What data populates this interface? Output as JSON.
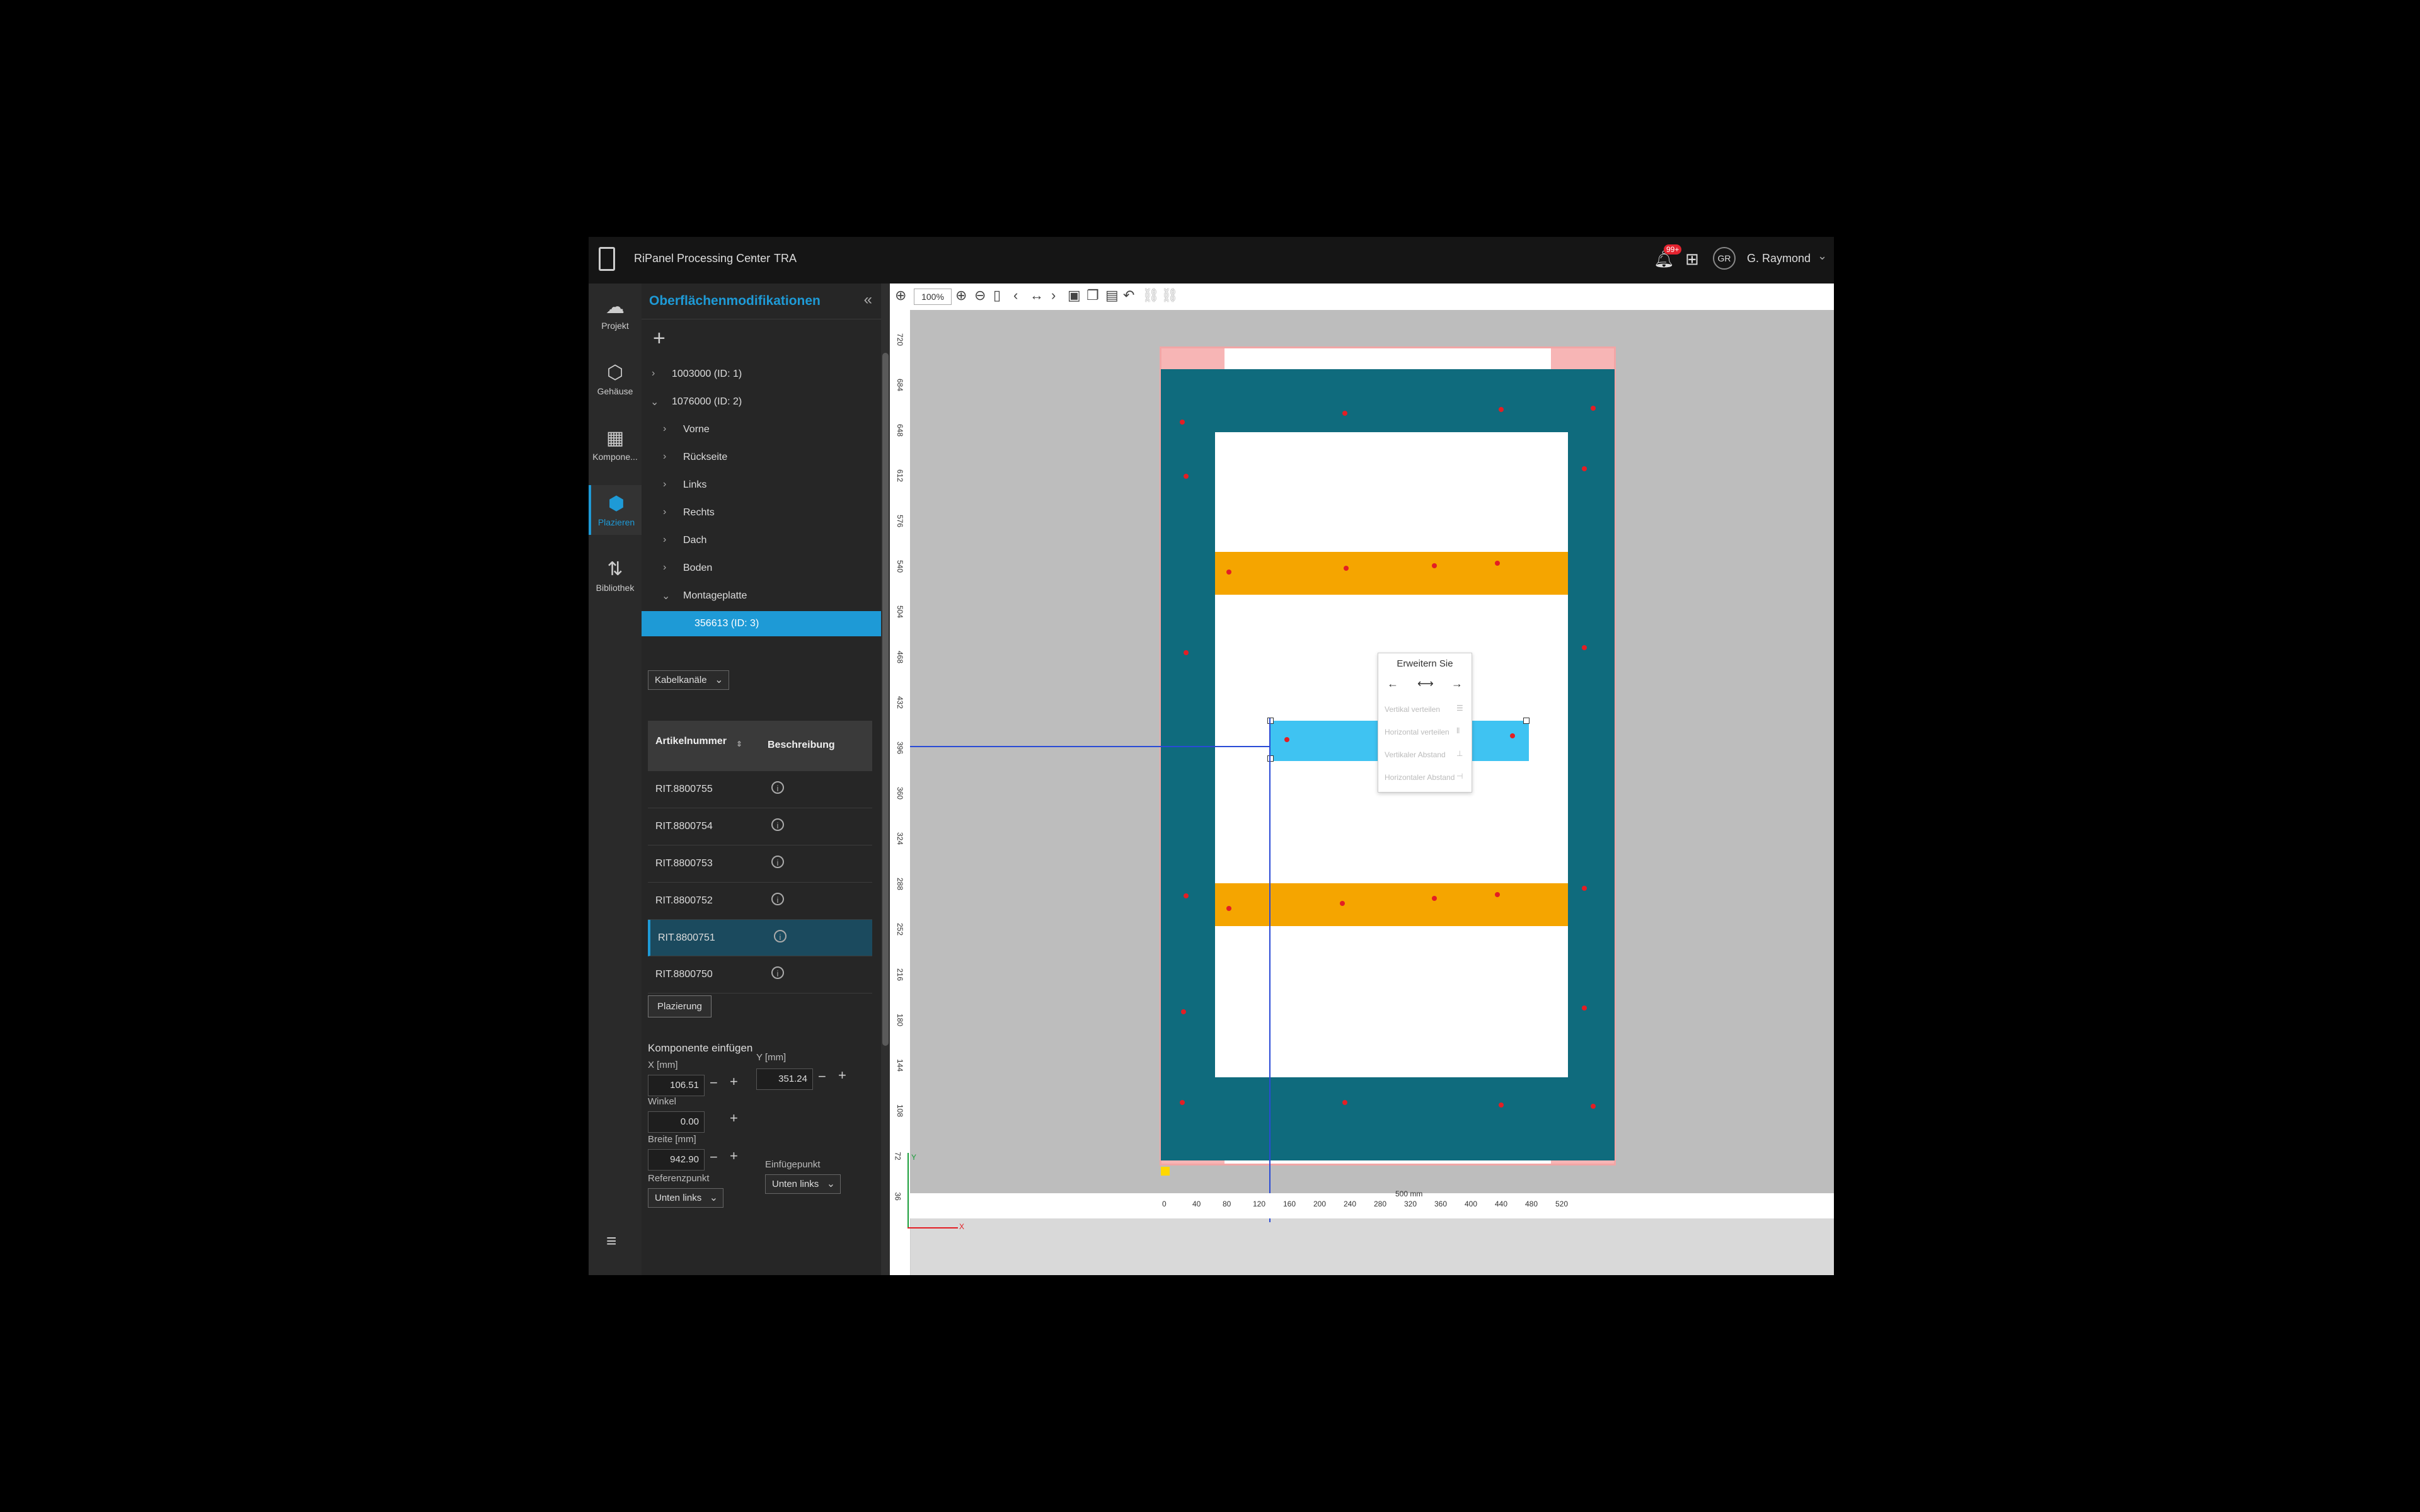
{
  "appbar": {
    "title": "RiPanel Processing Center",
    "breadcrumb_sep": "›",
    "breadcrumb": "TRA",
    "notification_badge": "99+",
    "avatar_initials": "GR",
    "user_name": "G. Raymond"
  },
  "rail": {
    "items": [
      {
        "label": "Projekt",
        "icon": "cloud-icon"
      },
      {
        "label": "Gehäuse",
        "icon": "cube-icon"
      },
      {
        "label": "Kompone...",
        "icon": "grid-icon"
      },
      {
        "label": "Plazieren",
        "icon": "box-place-icon",
        "active": true
      },
      {
        "label": "Bibliothek",
        "icon": "transfer-icon"
      }
    ]
  },
  "panel": {
    "title": "Oberflächenmodifikationen",
    "tree": [
      {
        "label": "1003000 (ID: 1)",
        "expanded": false
      },
      {
        "label": "1076000 (ID: 2)",
        "expanded": true
      },
      {
        "label": "Vorne"
      },
      {
        "label": "Rückseite"
      },
      {
        "label": "Links"
      },
      {
        "label": "Rechts"
      },
      {
        "label": "Dach"
      },
      {
        "label": "Boden"
      },
      {
        "label": "Montageplatte",
        "expanded": true
      },
      {
        "label": "356613 (ID: 3)",
        "selected": true
      }
    ],
    "filter_value": "Kabelkanäle",
    "table": {
      "col1": "Artikelnummer",
      "col2": "Beschreibung",
      "rows": [
        "RIT.8800755",
        "RIT.8800754",
        "RIT.8800753",
        "RIT.8800752",
        "RIT.8800751",
        "RIT.8800750"
      ],
      "selected_index": 4
    },
    "placement_button": "Plazierung",
    "insert_title": "Komponente einfügen",
    "x_label": "X [mm]",
    "x_value": "106.51",
    "y_label": "Y [mm]",
    "y_value": "351.24",
    "angle_label": "Winkel",
    "angle_value": "0.00",
    "width_label": "Breite [mm]",
    "width_value": "942.90",
    "ref_label": "Referenzpunkt",
    "ref_value": "Unten links",
    "insert_point_label": "Einfügepunkt",
    "insert_point_value": "Unten links"
  },
  "toolbar": {
    "zoom": "100%"
  },
  "canvas": {
    "ruler_left": [
      "720",
      "684",
      "648",
      "612",
      "576",
      "540",
      "504",
      "468",
      "432",
      "396",
      "360",
      "324",
      "288",
      "252",
      "216",
      "180",
      "144",
      "108",
      "72",
      "36"
    ],
    "ruler_bottom": [
      "0",
      "40",
      "80",
      "120",
      "160",
      "200",
      "240",
      "280",
      "320",
      "360",
      "400",
      "440",
      "480",
      "520"
    ],
    "ruler_bottom_mid": "500 mm",
    "context_menu": {
      "title": "Erweitern Sie",
      "items": [
        "Vertikal verteilen",
        "Horizontal verteilen",
        "Vertikaler Abstand",
        "Horizontaler Abstand"
      ]
    },
    "axis_x": "X",
    "axis_y": "Y"
  }
}
